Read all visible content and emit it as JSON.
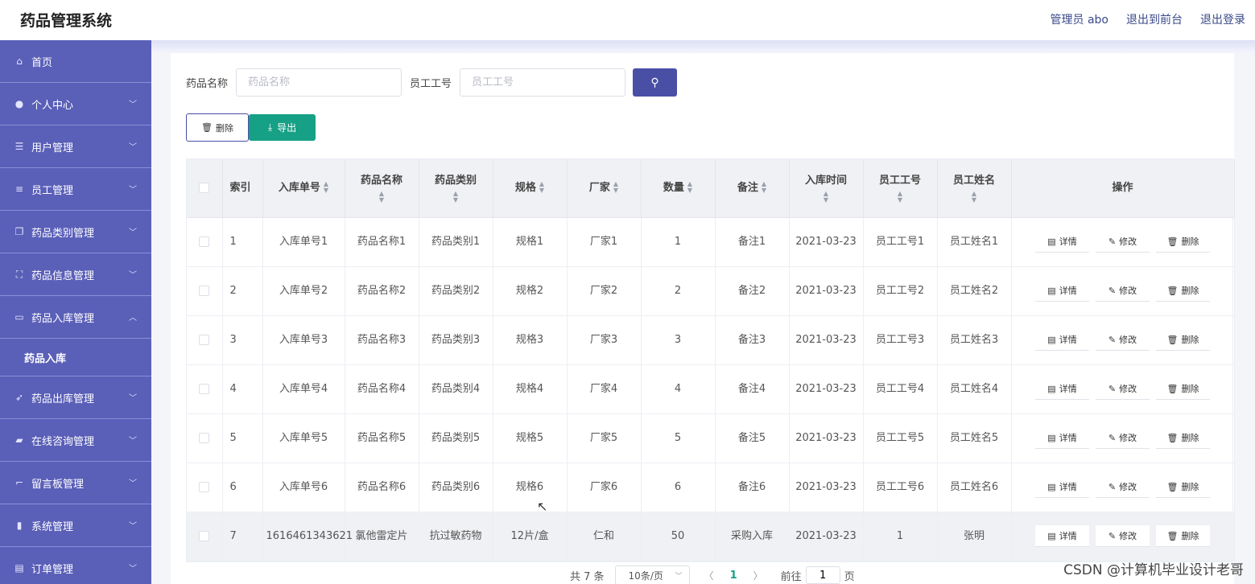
{
  "app": {
    "title": "药品管理系统"
  },
  "top_links": {
    "admin": "管理员 abo",
    "front": "退出到前台",
    "logout": "退出登录"
  },
  "sidebar": {
    "items": [
      {
        "label": "首页",
        "icon": "home-icon"
      },
      {
        "label": "个人中心",
        "icon": "user-icon"
      },
      {
        "label": "用户管理",
        "icon": "sliders-icon"
      },
      {
        "label": "员工管理",
        "icon": "list-icon"
      },
      {
        "label": "药品类别管理",
        "icon": "copy-icon"
      },
      {
        "label": "药品信息管理",
        "icon": "scan-icon"
      },
      {
        "label": "药品入库管理",
        "icon": "window-icon"
      },
      {
        "label": "药品出库管理",
        "icon": "send-icon"
      },
      {
        "label": "在线咨询管理",
        "icon": "chat-icon"
      },
      {
        "label": "留言板管理",
        "icon": "crop-icon"
      },
      {
        "label": "系统管理",
        "icon": "bar-chart-icon"
      },
      {
        "label": "订单管理",
        "icon": "cart-icon"
      }
    ],
    "sub_item": "药品入库"
  },
  "search": {
    "name_label": "药品名称",
    "name_placeholder": "药品名称",
    "emp_label": "员工工号",
    "emp_placeholder": "员工工号"
  },
  "actions": {
    "delete": "删除",
    "export": "导出"
  },
  "table": {
    "headers": {
      "index": "索引",
      "order_no": "入库单号",
      "drug_name": "药品名称",
      "category": "药品类别",
      "spec": "规格",
      "maker": "厂家",
      "qty": "数量",
      "note": "备注",
      "time": "入库时间",
      "emp_no": "员工工号",
      "emp_name": "员工姓名",
      "ops": "操作"
    },
    "op_labels": {
      "detail": "详情",
      "edit": "修改",
      "delete": "删除"
    },
    "rows": [
      {
        "index": "1",
        "order_no": "入库单号1",
        "drug_name": "药品名称1",
        "category": "药品类别1",
        "spec": "规格1",
        "maker": "厂家1",
        "qty": "1",
        "note": "备注1",
        "time": "2021-03-23",
        "emp_no": "员工工号1",
        "emp_name": "员工姓名1"
      },
      {
        "index": "2",
        "order_no": "入库单号2",
        "drug_name": "药品名称2",
        "category": "药品类别2",
        "spec": "规格2",
        "maker": "厂家2",
        "qty": "2",
        "note": "备注2",
        "time": "2021-03-23",
        "emp_no": "员工工号2",
        "emp_name": "员工姓名2"
      },
      {
        "index": "3",
        "order_no": "入库单号3",
        "drug_name": "药品名称3",
        "category": "药品类别3",
        "spec": "规格3",
        "maker": "厂家3",
        "qty": "3",
        "note": "备注3",
        "time": "2021-03-23",
        "emp_no": "员工工号3",
        "emp_name": "员工姓名3"
      },
      {
        "index": "4",
        "order_no": "入库单号4",
        "drug_name": "药品名称4",
        "category": "药品类别4",
        "spec": "规格4",
        "maker": "厂家4",
        "qty": "4",
        "note": "备注4",
        "time": "2021-03-23",
        "emp_no": "员工工号4",
        "emp_name": "员工姓名4"
      },
      {
        "index": "5",
        "order_no": "入库单号5",
        "drug_name": "药品名称5",
        "category": "药品类别5",
        "spec": "规格5",
        "maker": "厂家5",
        "qty": "5",
        "note": "备注5",
        "time": "2021-03-23",
        "emp_no": "员工工号5",
        "emp_name": "员工姓名5"
      },
      {
        "index": "6",
        "order_no": "入库单号6",
        "drug_name": "药品名称6",
        "category": "药品类别6",
        "spec": "规格6",
        "maker": "厂家6",
        "qty": "6",
        "note": "备注6",
        "time": "2021-03-23",
        "emp_no": "员工工号6",
        "emp_name": "员工姓名6"
      },
      {
        "index": "7",
        "order_no": "1616461343621",
        "drug_name": "氯他雷定片",
        "category": "抗过敏药物",
        "spec": "12片/盒",
        "maker": "仁和",
        "qty": "50",
        "note": "采购入库",
        "time": "2021-03-23",
        "emp_no": "1",
        "emp_name": "张明"
      }
    ]
  },
  "pager": {
    "total": "共 7 条",
    "page_size": "10条/页",
    "current": "1",
    "goto": "前往",
    "goto_value": "1",
    "page_unit": "页"
  },
  "watermark": "CSDN @计算机毕业设计老哥",
  "colors": {
    "sidebar": "#5a5fb8",
    "primary": "#4a4fa6",
    "export": "#16a085"
  }
}
